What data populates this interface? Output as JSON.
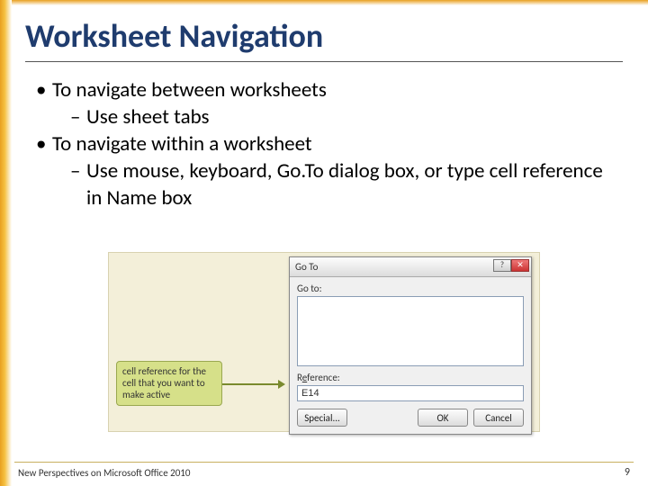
{
  "title": "Worksheet Navigation",
  "bullets": {
    "a": "To navigate between worksheets",
    "a1": "Use sheet tabs",
    "b": "To navigate within a worksheet",
    "b1": "Use mouse, keyboard, Go.To dialog box, or type cell reference in Name box"
  },
  "callout": "cell reference for the cell that you want to make active",
  "dialog": {
    "title": "Go To",
    "goto_label": "Go to:",
    "reference_label_pre": "R",
    "reference_label_underline": "e",
    "reference_label_post": "ference:",
    "reference_value": "E14",
    "special": "Special...",
    "ok": "OK",
    "cancel": "Cancel",
    "help_glyph": "?",
    "close_glyph": "✕"
  },
  "footer": {
    "left": "New Perspectives on Microsoft Office 2010",
    "page": "9"
  }
}
